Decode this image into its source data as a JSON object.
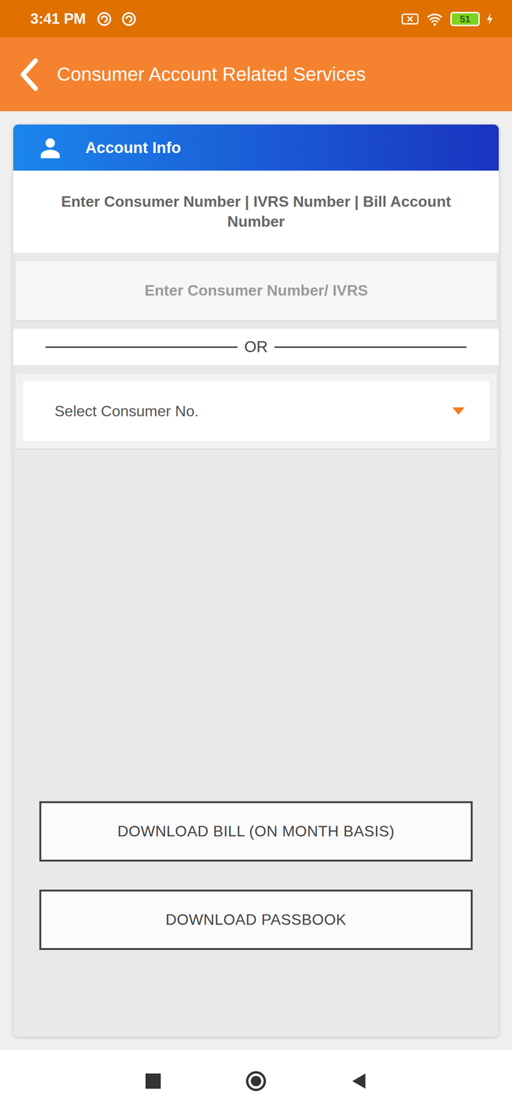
{
  "status_bar": {
    "time": "3:41 PM",
    "battery": "51"
  },
  "app_bar": {
    "title": "Consumer Account Related Services"
  },
  "card": {
    "title": "Account Info",
    "instruction": "Enter Consumer Number | IVRS Number | Bill Account Number"
  },
  "consumer_input": {
    "placeholder": "Enter Consumer Number/ IVRS"
  },
  "divider": "OR",
  "consumer_select": {
    "placeholder": "Select Consumer No.",
    "expanded": false
  },
  "buttons": [
    "DOWNLOAD BILL (ON MONTH BASIS)",
    "DOWNLOAD PASSBOOK"
  ]
}
